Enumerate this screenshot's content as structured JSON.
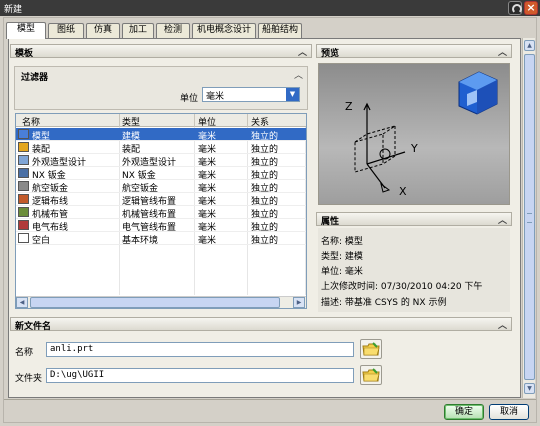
{
  "window": {
    "title": "新建"
  },
  "tabs": [
    "模型",
    "图纸",
    "仿真",
    "加工",
    "检测",
    "机电概念设计",
    "船舶结构"
  ],
  "active_tab": 0,
  "templates": {
    "header": "模板",
    "filter": {
      "header": "过滤器",
      "unit_label": "单位",
      "unit_value": "毫米"
    },
    "columns": [
      "名称",
      "类型",
      "单位",
      "关系"
    ],
    "rows": [
      {
        "name": "模型",
        "type": "建模",
        "unit": "毫米",
        "relation": "独立的",
        "icon": "model-icon"
      },
      {
        "name": "装配",
        "type": "装配",
        "unit": "毫米",
        "relation": "独立的",
        "icon": "assembly-icon"
      },
      {
        "name": "外观造型设计",
        "type": "外观造型设计",
        "unit": "毫米",
        "relation": "独立的",
        "icon": "shape-design-icon"
      },
      {
        "name": "NX 钣金",
        "type": "NX 钣金",
        "unit": "毫米",
        "relation": "独立的",
        "icon": "sheet-metal-icon"
      },
      {
        "name": "航空钣金",
        "type": "航空钣金",
        "unit": "毫米",
        "relation": "独立的",
        "icon": "aero-sheet-metal-icon"
      },
      {
        "name": "逻辑布线",
        "type": "逻辑管线布置",
        "unit": "毫米",
        "relation": "独立的",
        "icon": "logical-routing-icon"
      },
      {
        "name": "机械布管",
        "type": "机械管线布置",
        "unit": "毫米",
        "relation": "独立的",
        "icon": "mechanical-routing-icon"
      },
      {
        "name": "电气布线",
        "type": "电气管线布置",
        "unit": "毫米",
        "relation": "独立的",
        "icon": "electrical-routing-icon"
      },
      {
        "name": "空白",
        "type": "基本环境",
        "unit": "毫米",
        "relation": "独立的",
        "icon": "blank-icon"
      }
    ],
    "selected_row": 0
  },
  "preview": {
    "header": "预览",
    "axes": [
      "Z",
      "Y",
      "X"
    ]
  },
  "properties": {
    "header": "属性",
    "lines": [
      "名称:  模型",
      "类型:  建模",
      "单位:  毫米",
      "上次修改时间:   07/30/2010 04:20 下午",
      "描述:  带基准 CSYS 的 NX 示例"
    ]
  },
  "new_file": {
    "header": "新文件名",
    "name_label": "名称",
    "name_value": "anli.prt",
    "folder_label": "文件夹",
    "folder_value": "D:\\ug\\UGII"
  },
  "buttons": {
    "ok": "确定",
    "cancel": "取消"
  },
  "colors": {
    "selection": "#316ac5",
    "titlebar": "#3a3a3a",
    "accent_blue": "#2a6fd6"
  }
}
